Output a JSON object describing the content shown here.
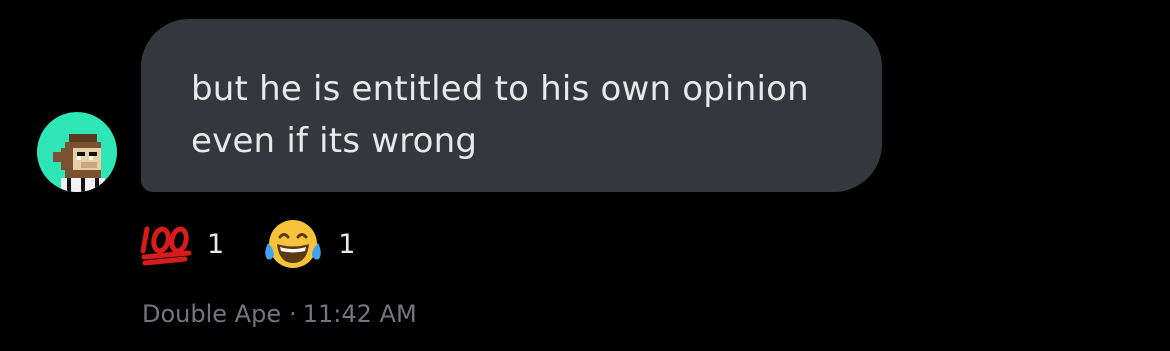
{
  "message": {
    "text": "but he is entitled to his own opinion\neven if its wrong",
    "sender": "Double Ape",
    "separator": "·",
    "time": "11:42 AM"
  },
  "reactions": [
    {
      "icon": "hundred-points-icon",
      "count": "1"
    },
    {
      "icon": "face-with-tears-of-joy-icon",
      "count": "1"
    }
  ],
  "colors": {
    "background": "#000000",
    "bubble": "#34373b",
    "text": "#e7e9ea",
    "meta": "#71767b",
    "avatar_bg": "#2ee6b6"
  }
}
